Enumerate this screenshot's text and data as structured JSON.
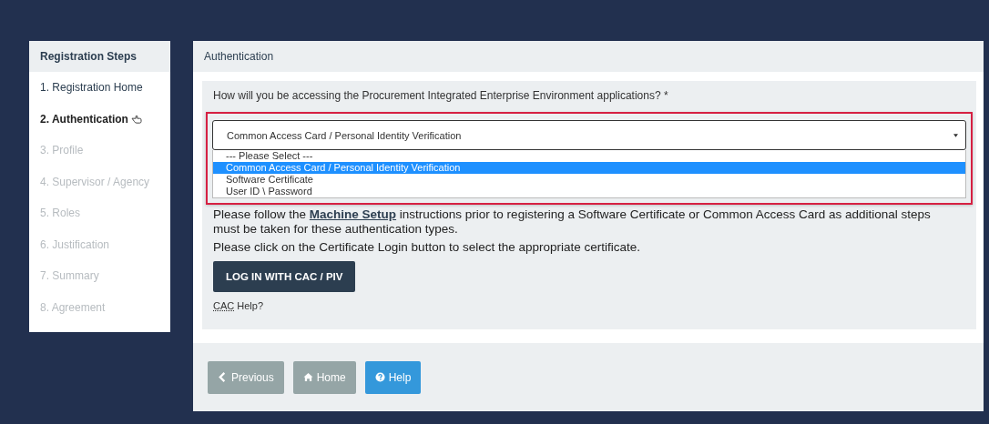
{
  "sidebar": {
    "title": "Registration Steps",
    "items": [
      {
        "label": "1. Registration Home",
        "selected": false,
        "disabled": false
      },
      {
        "label": "2. Authentication",
        "selected": true,
        "disabled": false
      },
      {
        "label": "3. Profile",
        "selected": false,
        "disabled": true
      },
      {
        "label": "4. Supervisor / Agency",
        "selected": false,
        "disabled": true
      },
      {
        "label": "5. Roles",
        "selected": false,
        "disabled": true
      },
      {
        "label": "6. Justification",
        "selected": false,
        "disabled": true
      },
      {
        "label": "7. Summary",
        "selected": false,
        "disabled": true
      },
      {
        "label": "8. Agreement",
        "selected": false,
        "disabled": true
      }
    ]
  },
  "panel": {
    "title": "Authentication",
    "question": "How will you be accessing the Procurement Integrated Enterprise Environment applications? *",
    "select": {
      "value": "Common Access Card / Personal Identity Verification",
      "options": [
        {
          "label": "--- Please Select ---",
          "selected": false
        },
        {
          "label": "Common Access Card / Personal Identity Verification",
          "selected": true
        },
        {
          "label": "Software Certificate",
          "selected": false
        },
        {
          "label": "User ID \\ Password",
          "selected": false
        }
      ]
    },
    "instructions": {
      "before": "Please follow the ",
      "link": "Machine Setup",
      "after": " instructions prior to registering a Software Certificate or Common Access Card as additional steps must be taken for these authentication types."
    },
    "certificate_note": "Please click on the Certificate Login button to select the appropriate certificate.",
    "login_button": "LOG IN WITH CAC / PIV",
    "help_link": {
      "abbr": "CAC",
      "text": "Help?"
    }
  },
  "footer": {
    "buttons": [
      {
        "kind": "previous",
        "label": "Previous"
      },
      {
        "kind": "home",
        "label": "Home"
      },
      {
        "kind": "help",
        "label": "Help"
      }
    ]
  }
}
